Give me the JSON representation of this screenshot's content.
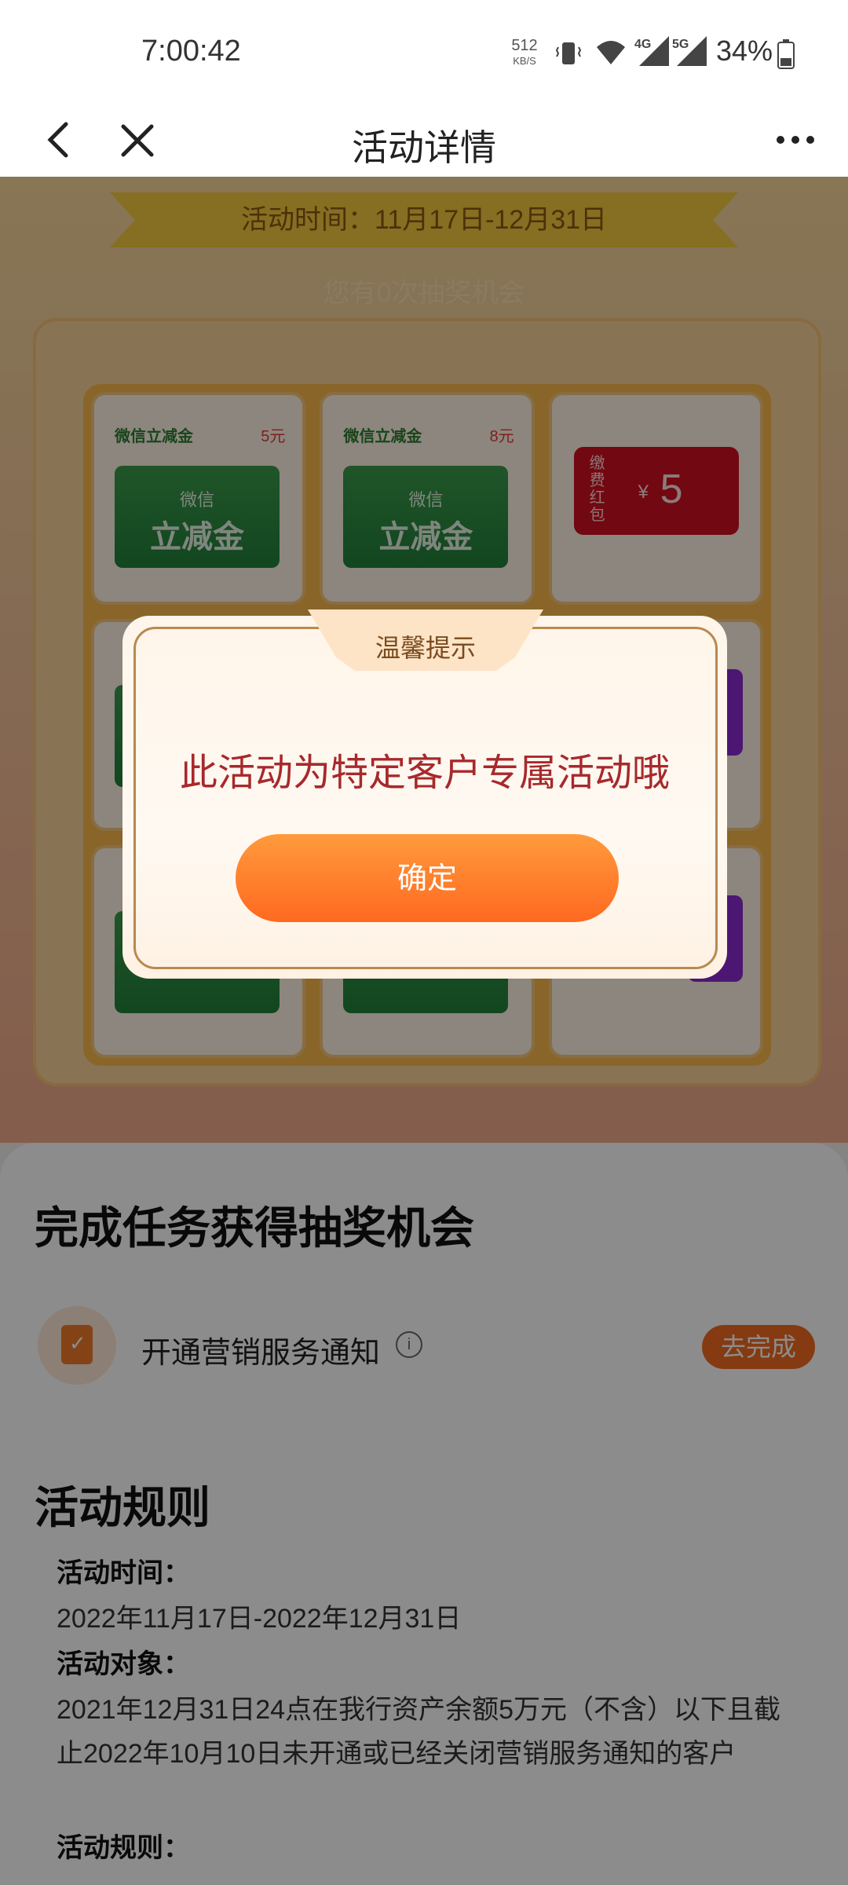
{
  "status_bar": {
    "time": "7:00:42",
    "net_speed_value": "512",
    "net_speed_unit": "KB/S",
    "signal_4g": "4G",
    "signal_5g": "5G",
    "battery": "34%"
  },
  "header": {
    "back_icon": "back-arrow-icon",
    "close_icon": "close-icon",
    "title": "活动详情",
    "more_icon": "more-icon"
  },
  "activity": {
    "time_banner": "活动时间：11月17日-12月31日",
    "chances_text": "您有0次抽奖机会",
    "prizes": [
      {
        "title": "微信立减金",
        "value": "5元",
        "card_small": "微信",
        "card_big": "立减金"
      },
      {
        "title": "微信立减金",
        "value": "8元",
        "card_small": "微信",
        "card_big": "立减金"
      },
      {
        "type": "red_packet",
        "vertical": "缴费红包",
        "currency": "¥",
        "amount": "5"
      }
    ]
  },
  "tasks": {
    "title": "完成任务获得抽奖机会",
    "items": [
      {
        "label": "开通营销服务通知",
        "button": "去完成"
      }
    ]
  },
  "rules": {
    "title": "活动规则",
    "lines": [
      {
        "text": "活动时间：",
        "bold": true
      },
      {
        "text": "2022年11月17日-2022年12月31日",
        "bold": false
      },
      {
        "text": "活动对象：",
        "bold": true
      },
      {
        "text": "2021年12月31日24点在我行资产余额5万元（不含）以下且截止2022年10月10日未开通或已经关闭营销服务通知的客户",
        "bold": false
      },
      {
        "text": "活动规则：",
        "bold": true
      }
    ]
  },
  "dialog": {
    "tab_title": "温馨提示",
    "message": "此活动为特定客户专属活动哦",
    "ok_button": "确定"
  },
  "colors": {
    "accent": "#ff6920",
    "message_red": "#a7292c",
    "task_button": "#f26b1f"
  }
}
